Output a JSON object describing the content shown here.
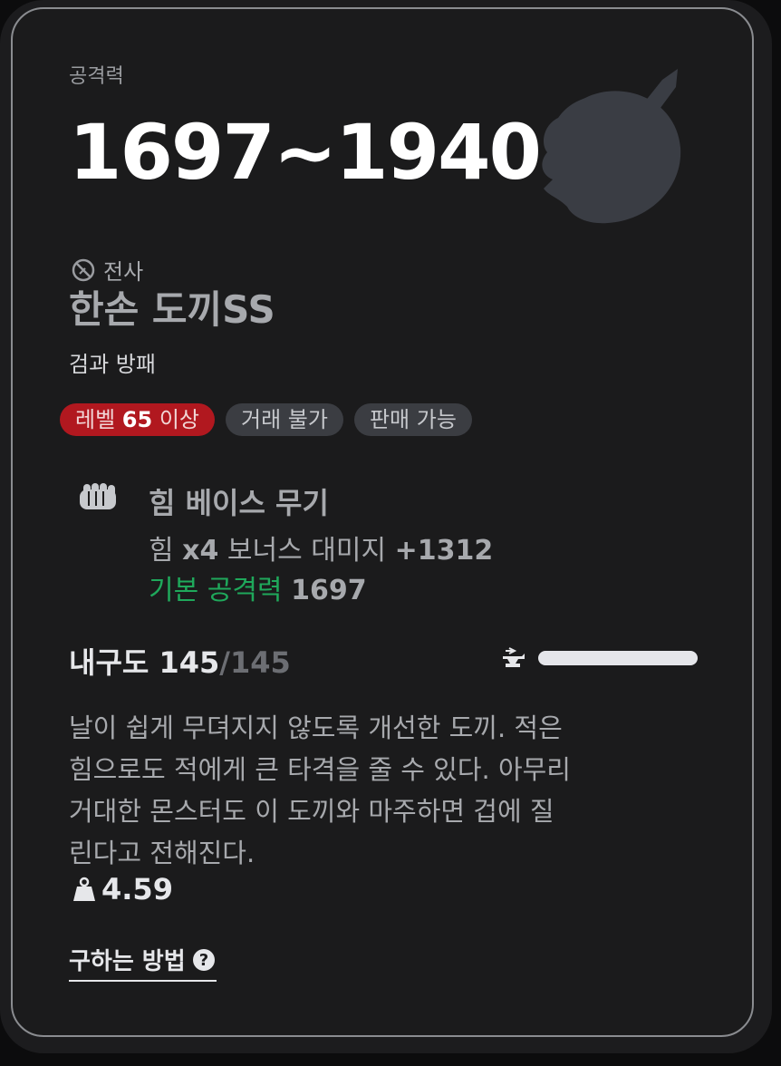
{
  "card": {
    "attack_label": "공격력",
    "attack_range": "1697~1940",
    "class_icon": "class-emblem-icon",
    "class_name": "전사",
    "item_name": "한손 도끼SS",
    "item_type": "검과 방패",
    "badges": {
      "level_prefix": "레벨 ",
      "level_value": "65",
      "level_suffix": " 이상",
      "trade": "거래 불가",
      "sell": "판매 가능"
    },
    "stat": {
      "icon": "fist-icon",
      "title": "힘 베이스 무기",
      "line1_prefix": "힘 ",
      "line1_mult": "x4",
      "line1_mid": " 보너스 대미지 ",
      "line1_value": "+1312",
      "line2_label": "기본 공격력",
      "line2_value": "1697"
    },
    "durability": {
      "label": "내구도",
      "current": "145",
      "max": "/145",
      "level": 1.0,
      "icon": "anvil-icon"
    },
    "description": "날이 쉽게 무뎌지지 않도록 개선한 도끼. 적은 힘으로도 적에게 큰 타격을 줄 수 있다. 아무리 거대한 몬스터도 이 도끼와 마주하면 겁에 질린다고 전해진다.",
    "weight": "4.59",
    "weight_icon": "weight-icon",
    "how_to_get": "구하는 방법",
    "help_icon": "question-icon"
  },
  "colors": {
    "level_badge": "#b1181f",
    "green_text": "#1fa85b",
    "card_bg": "#1b1b1c"
  }
}
